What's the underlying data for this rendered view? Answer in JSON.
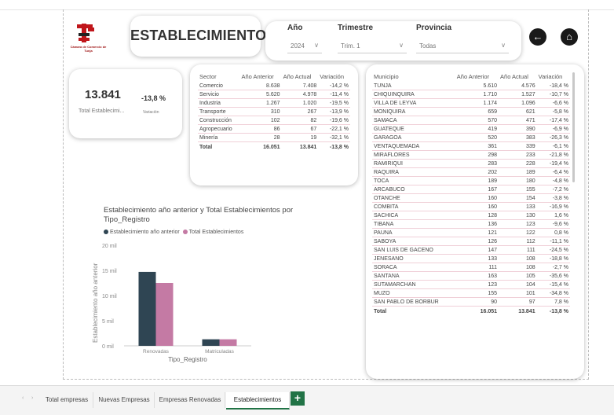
{
  "header": {
    "title": "ESTABLECIMIENTOS",
    "logo_text": "Cámara de Comercio de Tunja"
  },
  "filters": {
    "year_label": "Año",
    "year_value": "2024",
    "quarter_label": "Trimestre",
    "quarter_value": "Trim. 1",
    "province_label": "Provincia",
    "province_value": "Todas"
  },
  "nav": {
    "back_glyph": "←",
    "home_glyph": "⌂"
  },
  "kpi": {
    "total_value": "13.841",
    "total_label": "Total Establecimi...",
    "variation_value": "-13,8 %",
    "variation_label": "Variación"
  },
  "sector_table": {
    "headers": [
      "Sector",
      "Año Anterior",
      "Año Actual",
      "Variación"
    ],
    "rows": [
      [
        "Comercio",
        "8.638",
        "7.408",
        "-14,2 %"
      ],
      [
        "Servicio",
        "5.620",
        "4.978",
        "-11,4 %"
      ],
      [
        "Industria",
        "1.267",
        "1.020",
        "-19,5 %"
      ],
      [
        "Transporte",
        "310",
        "267",
        "-13,9 %"
      ],
      [
        "Construcción",
        "102",
        "82",
        "-19,6 %"
      ],
      [
        "Agropecuario",
        "86",
        "67",
        "-22,1 %"
      ],
      [
        "Minería",
        "28",
        "19",
        "-32,1 %"
      ]
    ],
    "total": [
      "Total",
      "16.051",
      "13.841",
      "-13,8 %"
    ]
  },
  "municipio_table": {
    "headers": [
      "Municipio",
      "Año Anterior",
      "Año Actual",
      "Variación"
    ],
    "rows": [
      [
        "TUNJA",
        "5.610",
        "4.576",
        "-18,4 %"
      ],
      [
        "CHIQUINQUIRA",
        "1.710",
        "1.527",
        "-10,7 %"
      ],
      [
        "VILLA DE LEYVA",
        "1.174",
        "1.096",
        "-6,6 %"
      ],
      [
        "MONIQUIRA",
        "659",
        "621",
        "-5,8 %"
      ],
      [
        "SAMACA",
        "570",
        "471",
        "-17,4 %"
      ],
      [
        "GUATEQUE",
        "419",
        "390",
        "-6,9 %"
      ],
      [
        "GARAGOA",
        "520",
        "383",
        "-26,3 %"
      ],
      [
        "VENTAQUEMADA",
        "361",
        "339",
        "-6,1 %"
      ],
      [
        "MIRAFLORES",
        "298",
        "233",
        "-21,8 %"
      ],
      [
        "RAMIRIQUI",
        "283",
        "228",
        "-19,4 %"
      ],
      [
        "RAQUIRA",
        "202",
        "189",
        "-6,4 %"
      ],
      [
        "TOCA",
        "189",
        "180",
        "-4,8 %"
      ],
      [
        "ARCABUCO",
        "167",
        "155",
        "-7,2 %"
      ],
      [
        "OTANCHE",
        "160",
        "154",
        "-3,8 %"
      ],
      [
        "COMBITA",
        "160",
        "133",
        "-16,9 %"
      ],
      [
        "SACHICA",
        "128",
        "130",
        "1,6 %"
      ],
      [
        "TIBANA",
        "136",
        "123",
        "-9,6 %"
      ],
      [
        "PAUNA",
        "121",
        "122",
        "0,8 %"
      ],
      [
        "SABOYA",
        "126",
        "112",
        "-11,1 %"
      ],
      [
        "SAN LUIS DE GACENO",
        "147",
        "111",
        "-24,5 %"
      ],
      [
        "JENESANO",
        "133",
        "108",
        "-18,8 %"
      ],
      [
        "SORACA",
        "111",
        "108",
        "-2,7 %"
      ],
      [
        "SANTANA",
        "163",
        "105",
        "-35,6 %"
      ],
      [
        "SUTAMARCHAN",
        "123",
        "104",
        "-15,4 %"
      ],
      [
        "MUZO",
        "155",
        "101",
        "-34,8 %"
      ],
      [
        "SAN PABLO DE BORBUR",
        "90",
        "97",
        "7,8 %"
      ]
    ],
    "total": [
      "Total",
      "16.051",
      "13.841",
      "-13,8 %"
    ]
  },
  "chart_data": {
    "type": "bar",
    "title": "Establecimiento año anterior y Total Establecimientos por Tipo_Registro",
    "xlabel": "Tipo_Registro",
    "ylabel": "Establecimiento año anterior",
    "categories": [
      "Renovadas",
      "Matriculadas"
    ],
    "series": [
      {
        "name": "Establecimiento año anterior",
        "color": "#2f4553",
        "values": [
          14700,
          1300
        ]
      },
      {
        "name": "Total Establecimientos",
        "color": "#c47aa4",
        "values": [
          12500,
          1300
        ]
      }
    ],
    "ylim": [
      0,
      20000
    ],
    "yticks": [
      "0 mil",
      "5 mil",
      "10 mil",
      "15 mil",
      "20 mil"
    ],
    "ytick_values": [
      0,
      5000,
      10000,
      15000,
      20000
    ],
    "legend": "top-left",
    "grid": false
  },
  "tabs": {
    "items": [
      "Total empresas",
      "Nuevas Empresas",
      "Empresas Renovadas",
      "Establecimientos"
    ],
    "active": "Establecimientos",
    "add_glyph": "+"
  }
}
